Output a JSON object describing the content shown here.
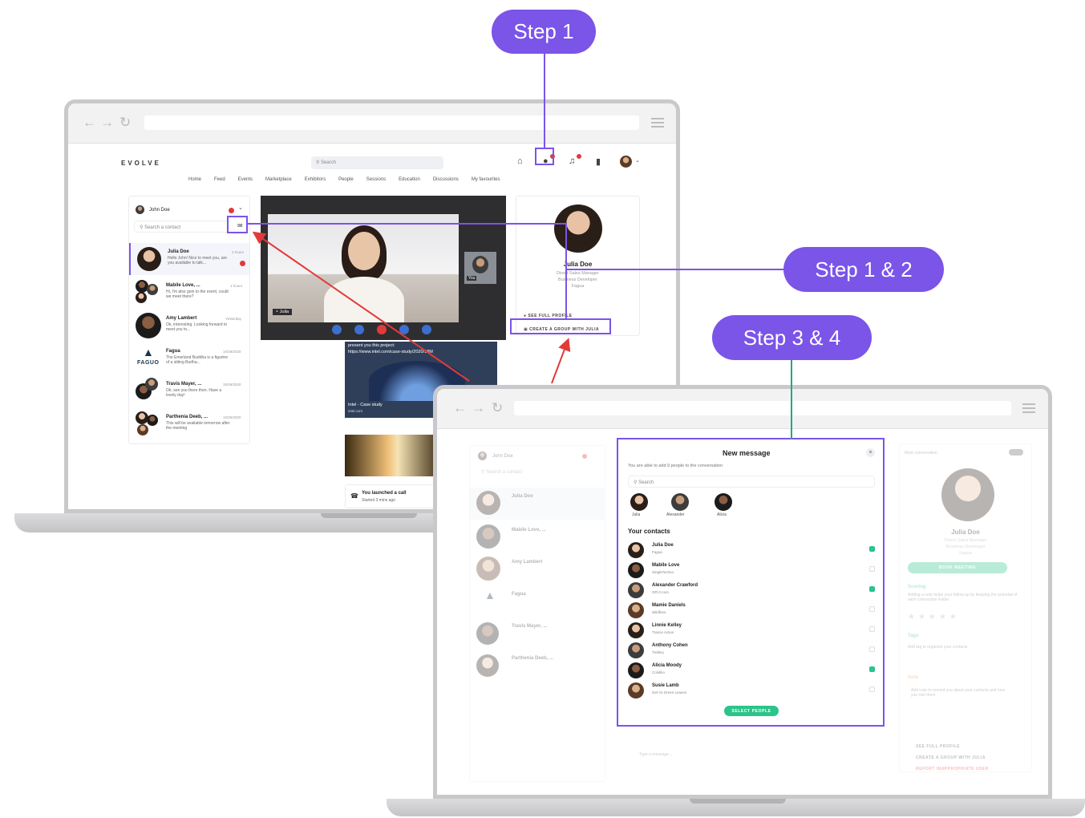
{
  "callouts": {
    "step1": "Step 1",
    "step12": "Step 1 & 2",
    "step34": "Step 3 & 4"
  },
  "colors": {
    "accent": "#7b54e8",
    "connector_green": "#22a884",
    "arrow_red": "#e23a3a",
    "confirm_green": "#2bc48a"
  },
  "laptop1": {
    "app": {
      "logo": "EVOLVE",
      "search_placeholder": "Search",
      "menu": [
        "Home",
        "Feed",
        "Events",
        "Marketplace",
        "Exhibitors",
        "People",
        "Sessions",
        "Education",
        "Discussions",
        "My favourites"
      ],
      "icons": [
        "home-icon",
        "group-chat-icon",
        "bell-icon",
        "bookmark-icon",
        "avatar"
      ]
    },
    "inbox": {
      "user": "John Doe",
      "search_placeholder": "Search a contact",
      "conversations": [
        {
          "name": "Julia Doe",
          "text": "Hello John! Nice to meet you, are you available to talk...",
          "time": "2 hours"
        },
        {
          "name": "Mabile Love, ...",
          "text": "Hi, I'm also goin to the event, could we meet there?",
          "time": "1 hours"
        },
        {
          "name": "Amy Lambert",
          "text": "Ok, interesting. Looking forward to meet you to...",
          "time": "Yesterday"
        },
        {
          "name": "Fagua",
          "text": "The Emerland Buddha is a figurine of a sitting Budha...",
          "time": "10/29/2020"
        },
        {
          "name": "Travis Mayer, ...",
          "text": "Ok, see you there then. Have a lovely day!",
          "time": "10/29/2020"
        },
        {
          "name": "Parthenia Deeb, ...",
          "text": "This will be available tomorrow after the meeting",
          "time": "10/20/2020"
        }
      ],
      "fagua_logo": "FAGUO"
    },
    "video": {
      "speaker_tag": "Julia",
      "self_tag": "You",
      "message": "present you this project:",
      "message_link": "https://www.intel.com/case-study/2020/18M",
      "card_title": "Intel - Case study",
      "card_domain": "intel.com",
      "call_title": "You launched a call",
      "call_sub": "Started 3 mins ago"
    },
    "profile": {
      "name": "Julia Doe",
      "role_line1": "Direct Sales Manager",
      "role_line2": "Business Developer",
      "company": "Fagua",
      "see_profile": "SEE FULL PROFILE",
      "create_group": "CREATE A GROUP WITH JULIA"
    }
  },
  "laptop2": {
    "bg_inbox": {
      "user": "John Doe",
      "search_placeholder": "Search a contact",
      "names": [
        "Julia Doe",
        "Mabile Love, ...",
        "Amy Lambert",
        "Fagua",
        "Travis Mayer, ...",
        "Parthenia Deeb, ..."
      ],
      "message_placeholder": "Type a message..."
    },
    "bg_profile": {
      "toggle_label": "Mute conversation",
      "name": "Julia Doe",
      "role_line1": "Direct Sales Manager",
      "role_line2": "Business Developer",
      "company": "Fagua",
      "book_meeting": "BOOK MEETING",
      "scoring_title": "Scoring",
      "scoring_text": "Adding a note helps your follow-up by keeping the potential of each connection inside.",
      "tags_title": "Tags",
      "tags_text": "Add tag to organize your contacts",
      "note_title": "Note",
      "note_text": "Add note to remind you about your contacts and how you met them",
      "see_profile": "SEE FULL PROFILE",
      "create_group": "CREATE A GROUP WITH JULIA",
      "report": "REPORT INAPPROPRIATE USER"
    },
    "modal": {
      "title": "New message",
      "subtitle": "You are able to add 9 people to the conversation",
      "search_placeholder": "Search",
      "selected": [
        "Julia",
        "Alexander",
        "Alicia"
      ],
      "contacts_title": "Your contacts",
      "contacts": [
        {
          "name": "Julia Doe",
          "company": "Fagua",
          "checked": true
        },
        {
          "name": "Mabile Love",
          "company": "SingleTechno",
          "checked": false
        },
        {
          "name": "Alexander Crawford",
          "company": "OPLY.com",
          "checked": true
        },
        {
          "name": "Mamie Daniels",
          "company": "Wildfires",
          "checked": false
        },
        {
          "name": "Linnie Kelley",
          "company": "Trance Action",
          "checked": false
        },
        {
          "name": "Anthony Cohen",
          "company": "Trellery",
          "checked": false
        },
        {
          "name": "Alicia Moody",
          "company": "Cololiko",
          "checked": true
        },
        {
          "name": "Susie Lamb",
          "company": "Get Yo Green Leaves",
          "checked": false
        }
      ],
      "select_button": "SELECT PEOPLE"
    }
  }
}
